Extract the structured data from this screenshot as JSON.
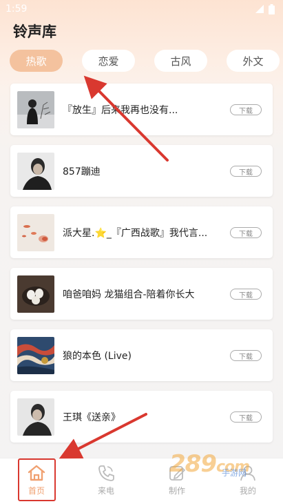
{
  "status_bar": {
    "time": "1:59"
  },
  "page": {
    "title": "铃声库"
  },
  "tabs": [
    {
      "label": "热歌",
      "active": true
    },
    {
      "label": "恋爱",
      "active": false
    },
    {
      "label": "古风",
      "active": false
    },
    {
      "label": "外文",
      "active": false
    }
  ],
  "songs": [
    {
      "title": "『放生』后来我再也没有...",
      "thumb": "man-in-snow",
      "download_label": "下载"
    },
    {
      "title": "857蹦迪",
      "thumb": "man-portrait",
      "download_label": "下载"
    },
    {
      "title": "派大星.⭐_『广西战歌』我代言...",
      "thumb": "petals",
      "download_label": "下载"
    },
    {
      "title": "咱爸咱妈 龙猫组合-陪着你长大",
      "thumb": "eggs-bowl",
      "download_label": "下载"
    },
    {
      "title": "狼的本色 (Live)",
      "thumb": "marble-art",
      "download_label": "下载"
    },
    {
      "title": "王琪《送亲》",
      "thumb": "man-portrait-2",
      "download_label": "下载"
    }
  ],
  "bottom_nav": [
    {
      "label": "首页",
      "icon": "home-icon",
      "active": true
    },
    {
      "label": "来电",
      "icon": "phone-icon",
      "active": false
    },
    {
      "label": "制作",
      "icon": "edit-icon",
      "active": false
    },
    {
      "label": "我的",
      "icon": "user-icon",
      "active": false
    }
  ],
  "watermark": {
    "main": "289",
    "suffix": "com",
    "sub": "手游网"
  },
  "colors": {
    "accent": "#f4c29e",
    "annotation_red": "#d9382f"
  }
}
